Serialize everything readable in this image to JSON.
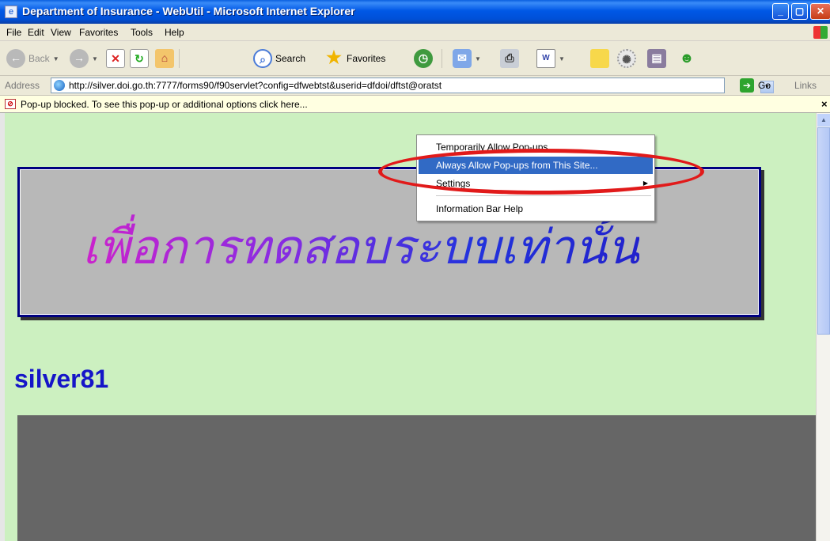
{
  "window": {
    "title": "Department of Insurance - WebUtil - Microsoft Internet Explorer"
  },
  "menu": [
    "File",
    "Edit",
    "View",
    "Favorites",
    "Tools",
    "Help"
  ],
  "toolbar": {
    "back": "Back",
    "search": "Search",
    "favorites": "Favorites"
  },
  "address": {
    "label": "Address",
    "url": "http://silver.doi.go.th:7777/forms90/f90servlet?config=dfwebtst&userid=dfdoi/dftst@oratst",
    "go": "Go",
    "links": "Links"
  },
  "infobar": {
    "message": "Pop-up blocked. To see this pop-up or additional options click here..."
  },
  "context_menu": {
    "items": [
      "Temporarily Allow Pop-ups",
      "Always Allow Pop-ups from This Site...",
      "Settings",
      "Information Bar Help"
    ],
    "selected_index": 1
  },
  "page": {
    "banner_text": "เพื่อการทดสอบระบบเท่านั้น",
    "hostname": "silver81"
  },
  "colors": {
    "page_background": "#CCF0C0",
    "applet_background": "#666666",
    "hostname_color": "#1515C8",
    "annotation": "#E11A1A",
    "menu_highlight": "#316AC5"
  }
}
